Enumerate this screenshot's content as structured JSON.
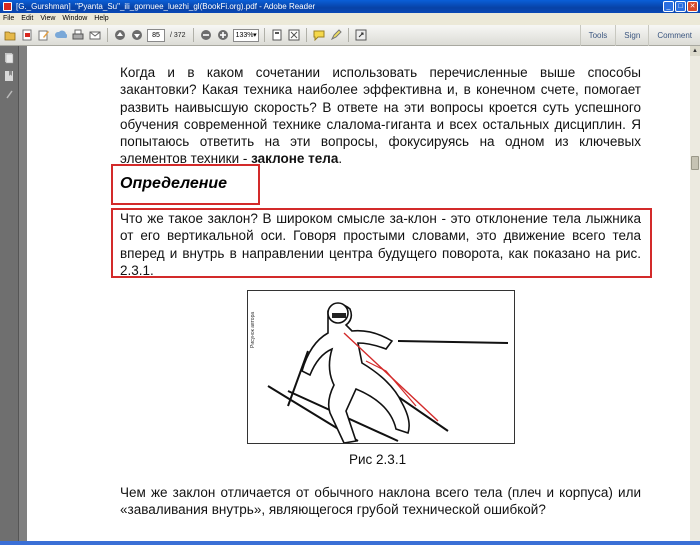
{
  "window": {
    "title": "[G._Gurshman]_\"Pyanta_Su\"_ili_gornuee_luezhi_gl(BookFi.org).pdf - Adobe Reader",
    "minimize": "_",
    "maximize": "□",
    "close": "✕"
  },
  "menu": [
    "File",
    "Edit",
    "View",
    "Window",
    "Help"
  ],
  "toolbar": {
    "page_current": "85",
    "page_total": "/ 372",
    "zoom": "133%",
    "links": [
      "Tools",
      "Sign",
      "Comment"
    ]
  },
  "document": {
    "para1": "Когда и в каком сочетании использовать перечисленные выше способы закантовки? Какая техника наиболее эффективна и, в конечном счете, помогает развить наивысшую скорость? В ответе на эти вопросы кроется суть успешного обучения современной технике слалома-гиганта и всех остальных дисциплин. Я попытаюсь ответить на эти вопросы, фокусируясь на одном из ключевых элементов техники -",
    "para1_bold": "заклоне тела",
    "para1_end": ".",
    "heading": "Определение",
    "definition": "Что же такое заклон? В широком смысле за-клон - это отклонение тела лыжника от его вертикальной оси. Говоря простыми словами, это движение всего тела вперед и внутрь в направлении центра будущего поворота, как показано на рис. 2.3.1.",
    "figure_side_label": "Рисунок автора",
    "caption": "Рис 2.3.1",
    "para2": "Чем же заклон отличается от обычного наклона всего тела (плеч и корпуса) или «заваливания внутрь», являющегося грубой технической ошибкой?"
  },
  "colors": {
    "title_bar": "#0842a6",
    "highlight_box": "#d32a2a",
    "panel": "#6f6f6f"
  }
}
